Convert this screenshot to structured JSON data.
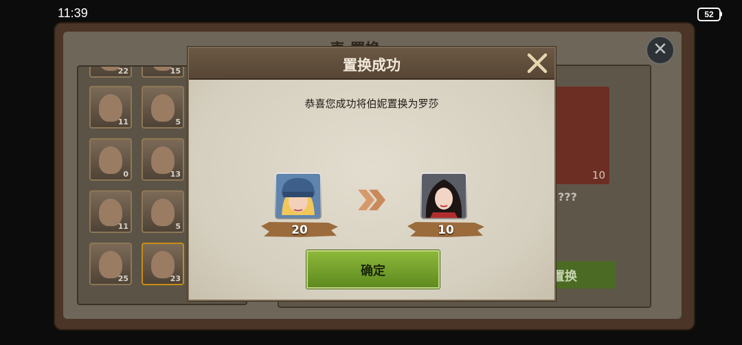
{
  "status_bar": {
    "time": "11:39",
    "battery": "52"
  },
  "background_screen": {
    "title": "表 置换",
    "hero_list": [
      {
        "level": "22"
      },
      {
        "level": "15"
      },
      {
        "level": "11"
      },
      {
        "level": "5"
      },
      {
        "level": "0"
      },
      {
        "level": "13"
      },
      {
        "level": "11"
      },
      {
        "level": "5"
      },
      {
        "level": "25"
      },
      {
        "level": "23"
      }
    ],
    "target_card_level": "10",
    "target_name": "???",
    "swap_button_label": "置换"
  },
  "dialog": {
    "title": "置换成功",
    "message": "恭喜您成功将伯妮置换为罗莎",
    "from_hero": {
      "level": "20"
    },
    "to_hero": {
      "level": "10"
    },
    "confirm_label": "确定"
  },
  "colors": {
    "confirm_green": "#7aa52e",
    "header_brown": "#5f4d3b",
    "ribbon_brown": "#9b6b3c"
  }
}
